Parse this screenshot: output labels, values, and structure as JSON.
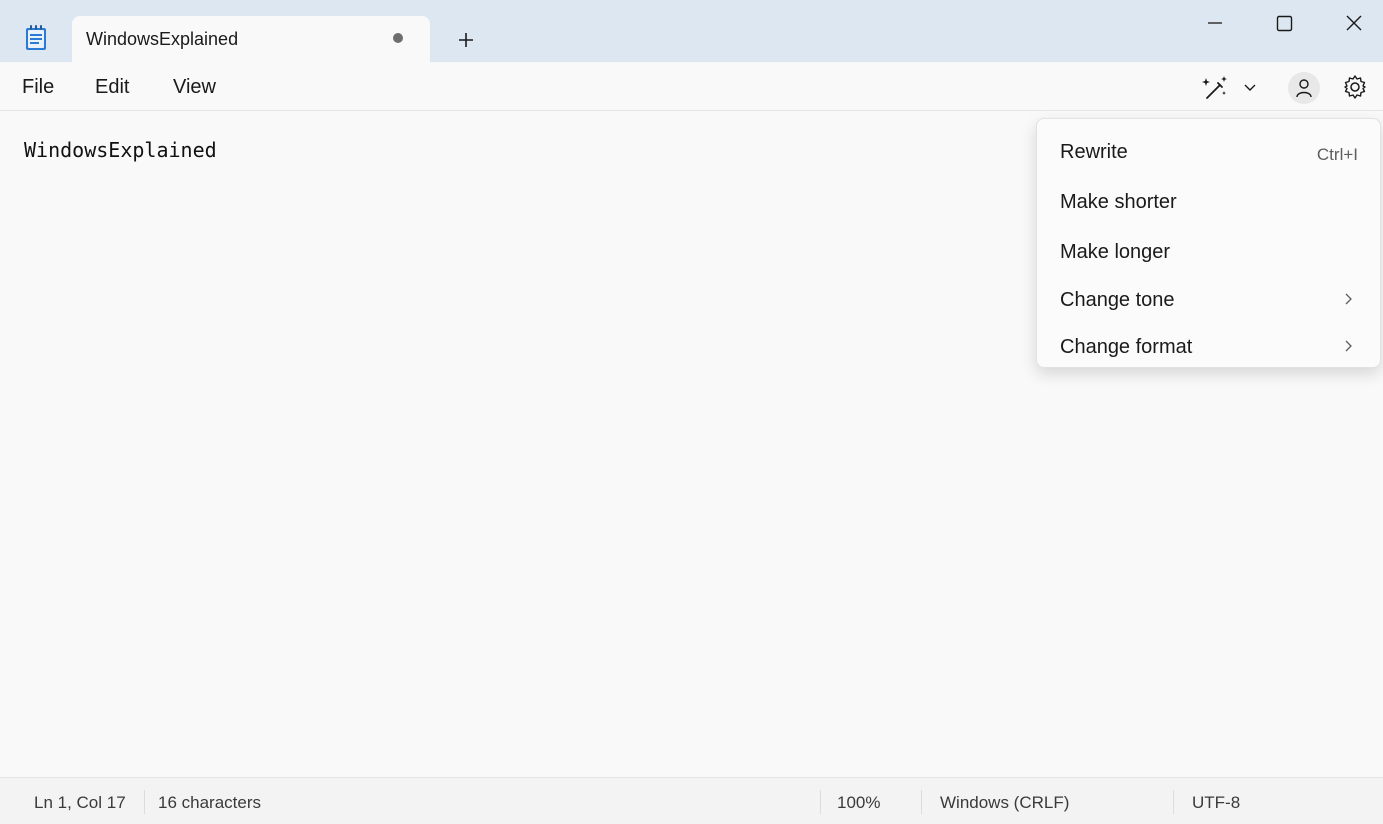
{
  "tab": {
    "title": "WindowsExplained"
  },
  "menubar": {
    "file": "File",
    "edit": "Edit",
    "view": "View"
  },
  "editor": {
    "content": "WindowsExplained"
  },
  "context_menu": {
    "items": [
      {
        "label": "Rewrite",
        "shortcut": "Ctrl+I"
      },
      {
        "label": "Make shorter"
      },
      {
        "label": "Make longer"
      },
      {
        "label": "Change tone",
        "has_submenu": true
      },
      {
        "label": "Change format",
        "has_submenu": true
      }
    ]
  },
  "statusbar": {
    "position": "Ln 1, Col 17",
    "characters": "16 characters",
    "zoom": "100%",
    "line_ending": "Windows (CRLF)",
    "encoding": "UTF-8"
  },
  "icons": {
    "app": "notepad-icon",
    "copilot": "copilot-rewrite-icon",
    "settings": "gear-icon",
    "account": "person-icon"
  },
  "colors": {
    "titlebar": "#dde7f1",
    "background": "#f9f9f9",
    "statusbar": "#f3f3f3"
  }
}
